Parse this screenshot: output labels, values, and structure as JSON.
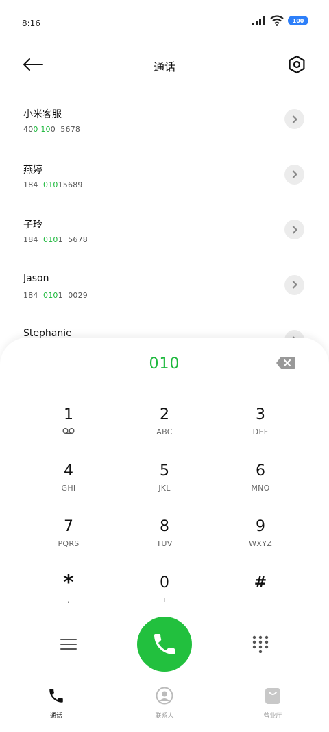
{
  "status": {
    "time": "8:16",
    "battery": "100"
  },
  "header": {
    "title": "通话"
  },
  "contacts": [
    {
      "name": "小米客服",
      "number": [
        {
          "t": "40"
        },
        {
          "t": "0",
          "hl": true
        },
        {
          "t": " "
        },
        {
          "t": "10",
          "hl": true
        },
        {
          "t": "0  5678"
        }
      ]
    },
    {
      "name": "燕婷",
      "number": [
        {
          "t": "184  "
        },
        {
          "t": "010",
          "hl": true
        },
        {
          "t": "15689"
        }
      ]
    },
    {
      "name": "子玲",
      "number": [
        {
          "t": "184  "
        },
        {
          "t": "010",
          "hl": true
        },
        {
          "t": "1  5678"
        }
      ]
    },
    {
      "name": "Jason",
      "number": [
        {
          "t": "184  "
        },
        {
          "t": "010",
          "hl": true
        },
        {
          "t": "1  0029"
        }
      ]
    },
    {
      "name": "Stephanie",
      "number": []
    }
  ],
  "dialer": {
    "input": "010"
  },
  "keys": [
    {
      "digit": "1",
      "letters": "",
      "voicemail": true
    },
    {
      "digit": "2",
      "letters": "ABC"
    },
    {
      "digit": "3",
      "letters": "DEF"
    },
    {
      "digit": "4",
      "letters": "GHI"
    },
    {
      "digit": "5",
      "letters": "JKL"
    },
    {
      "digit": "6",
      "letters": "MNO"
    },
    {
      "digit": "7",
      "letters": "PQRS"
    },
    {
      "digit": "8",
      "letters": "TUV"
    },
    {
      "digit": "9",
      "letters": "WXYZ"
    },
    {
      "digit": "*",
      "letters": ","
    },
    {
      "digit": "0",
      "letters": "+"
    },
    {
      "digit": "#",
      "letters": ""
    }
  ],
  "tabs": [
    {
      "label": "通话",
      "icon": "phone-icon",
      "active": true
    },
    {
      "label": "联系人",
      "icon": "person-icon",
      "active": false
    },
    {
      "label": "营业厅",
      "icon": "shopping-bag-icon",
      "active": false
    }
  ],
  "colors": {
    "accent": "#1db83c",
    "call_button": "#22c03e",
    "battery": "#2d7ff9"
  }
}
